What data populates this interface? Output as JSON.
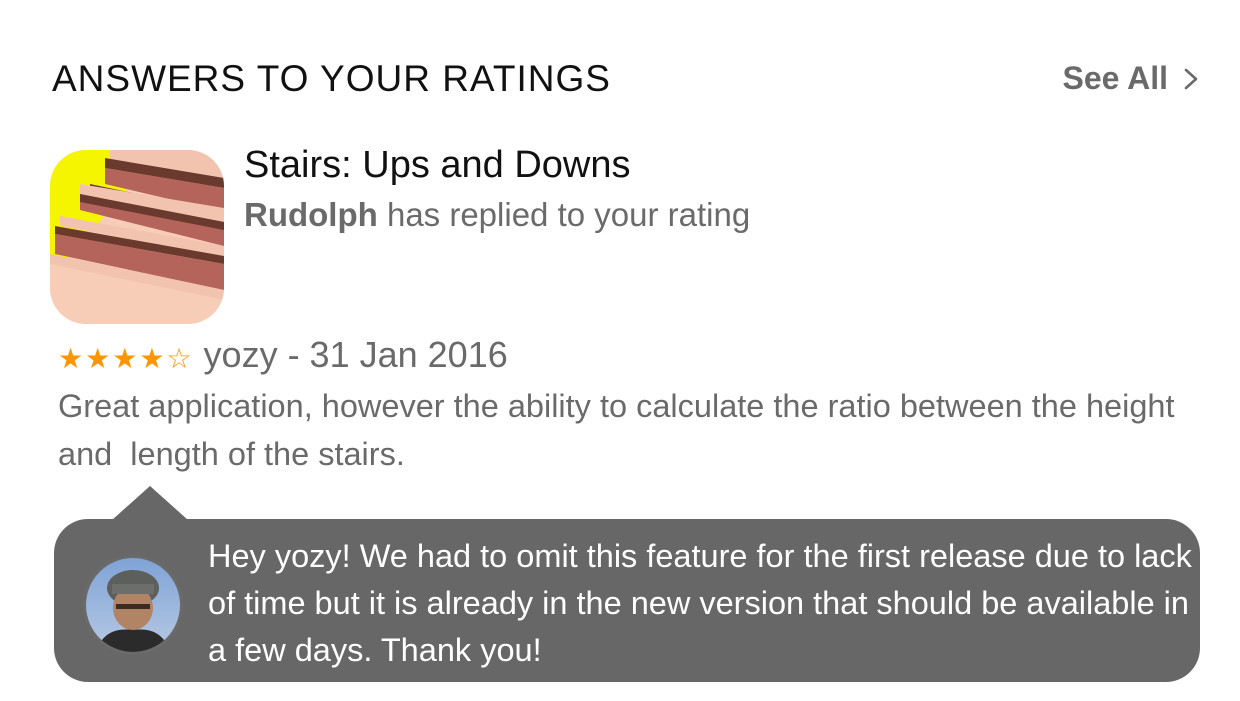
{
  "header": {
    "title": "ANSWERS TO YOUR RATINGS",
    "see_all_label": "See All"
  },
  "app": {
    "name": "Stairs: Ups and Downs",
    "replier": "Rudolph",
    "replied_text": " has replied to your rating",
    "icon": "stairs-app-icon"
  },
  "review": {
    "rating": 4,
    "max_rating": 5,
    "star_color": "#ff9500",
    "meta": "yozy - 31 Jan 2016",
    "text": "Great application, however the ability to calculate the ratio between the height and  length of the stairs."
  },
  "reply": {
    "text": "Hey yozy! We had to omit this feature for the first release due to lack of time but it is already in the new version that should be available in a few days. Thank you!",
    "bubble_color": "#676767"
  }
}
